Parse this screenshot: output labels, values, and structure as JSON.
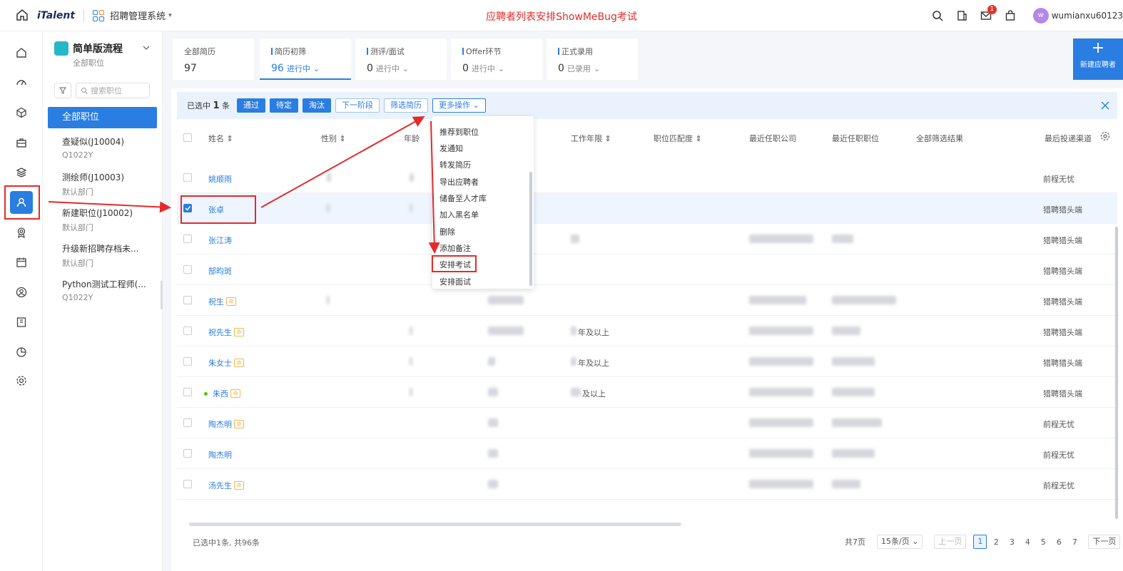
{
  "header": {
    "brand": "iTalent",
    "app_name": "招聘管理系统",
    "page_note": "应聘者列表安排ShowMeBug考试",
    "badge_count": "1",
    "avatar_letter": "w",
    "username": "wumianxu60123"
  },
  "side_panel": {
    "flow_title": "简单版流程",
    "flow_sub": "全部职位",
    "search_placeholder": "搜索职位",
    "active_position": "全部职位",
    "positions": [
      {
        "name": "查疑似(J10004)",
        "dept": "Q1022Y"
      },
      {
        "name": "测绘师(J10003)",
        "dept": "默认部门"
      },
      {
        "name": "新建职位(J10002)",
        "dept": "默认部门"
      },
      {
        "name": "升级新招聘存档未...",
        "dept": "默认部门"
      },
      {
        "name": "Python测试工程师(...",
        "dept": "Q1022Y"
      }
    ]
  },
  "stages": [
    {
      "label": "全部简历",
      "count": "97",
      "status": ""
    },
    {
      "label": "简历初筛",
      "count": "96",
      "status": "进行中"
    },
    {
      "label": "测评/面试",
      "count": "0",
      "status": "进行中"
    },
    {
      "label": "Offer环节",
      "count": "0",
      "status": "进行中"
    },
    {
      "label": "正式录用",
      "count": "0",
      "status": "已录用"
    }
  ],
  "new_button_label": "新建应聘者",
  "actionbar": {
    "selected_prefix": "已选中",
    "selected_count": "1",
    "selected_suffix": "条",
    "buttons": [
      "通过",
      "待定",
      "淘汰",
      "下一阶段",
      "筛选简历",
      "更多操作"
    ]
  },
  "columns": [
    "姓名",
    "性别",
    "年龄",
    "工作年限",
    "职位匹配度",
    "最近任职公司",
    "最近任职职位",
    "全部筛选结果",
    "最后投递渠道"
  ],
  "rows": [
    {
      "name": "姚顺雨",
      "channel": "前程无忧",
      "tag": false,
      "selected": false,
      "years": ""
    },
    {
      "name": "张卓",
      "channel": "猎聘猎头端",
      "tag": false,
      "selected": true,
      "years": ""
    },
    {
      "name": "张江涛",
      "channel": "猎聘猎头端",
      "tag": false,
      "selected": false,
      "years": ""
    },
    {
      "name": "郜昀斑",
      "channel": "猎聘猎头端",
      "tag": false,
      "selected": false,
      "years": ""
    },
    {
      "name": "祝生",
      "channel": "猎聘猎头端",
      "tag": true,
      "selected": false,
      "years": ""
    },
    {
      "name": "祝先生",
      "channel": "猎聘猎头端",
      "tag": true,
      "selected": false,
      "years": "年及以上"
    },
    {
      "name": "朱女士",
      "channel": "猎聘猎头端",
      "tag": true,
      "selected": false,
      "years": "年及以上"
    },
    {
      "name": "朱西",
      "channel": "猎聘猎头端",
      "tag": true,
      "selected": false,
      "years": "及以上"
    },
    {
      "name": "陶杰明",
      "channel": "前程无忧",
      "tag": true,
      "selected": false,
      "years": ""
    },
    {
      "name": "陶杰明",
      "channel": "前程无忧",
      "tag": false,
      "selected": false,
      "years": ""
    },
    {
      "name": "汤先生",
      "channel": "前程无忧",
      "tag": true,
      "selected": false,
      "years": ""
    }
  ],
  "more_menu": [
    "推荐到职位",
    "发通知",
    "转发简历",
    "导出应聘者",
    "储备至人才库",
    "加入黑名单",
    "删除",
    "添加备注",
    "安排考试",
    "安排面试"
  ],
  "footer": {
    "summary": "已选中1条, 共96条",
    "total_pages": "共7页",
    "page_size": "15条/页",
    "prev": "上一页",
    "next": "下一页",
    "pages": [
      "1",
      "2",
      "3",
      "4",
      "5",
      "6",
      "7"
    ],
    "current_page": "1"
  },
  "icons": {
    "rail": [
      "home-icon",
      "dashboard-icon",
      "cube-icon",
      "briefcase-icon",
      "layers-icon",
      "candidates-icon",
      "award-icon",
      "calendar-icon",
      "user-circle-icon",
      "bookmark-icon",
      "pie-chart-icon",
      "settings-icon"
    ]
  },
  "colors": {
    "accent": "#2a7de1",
    "annotation": "#e42b2b"
  }
}
